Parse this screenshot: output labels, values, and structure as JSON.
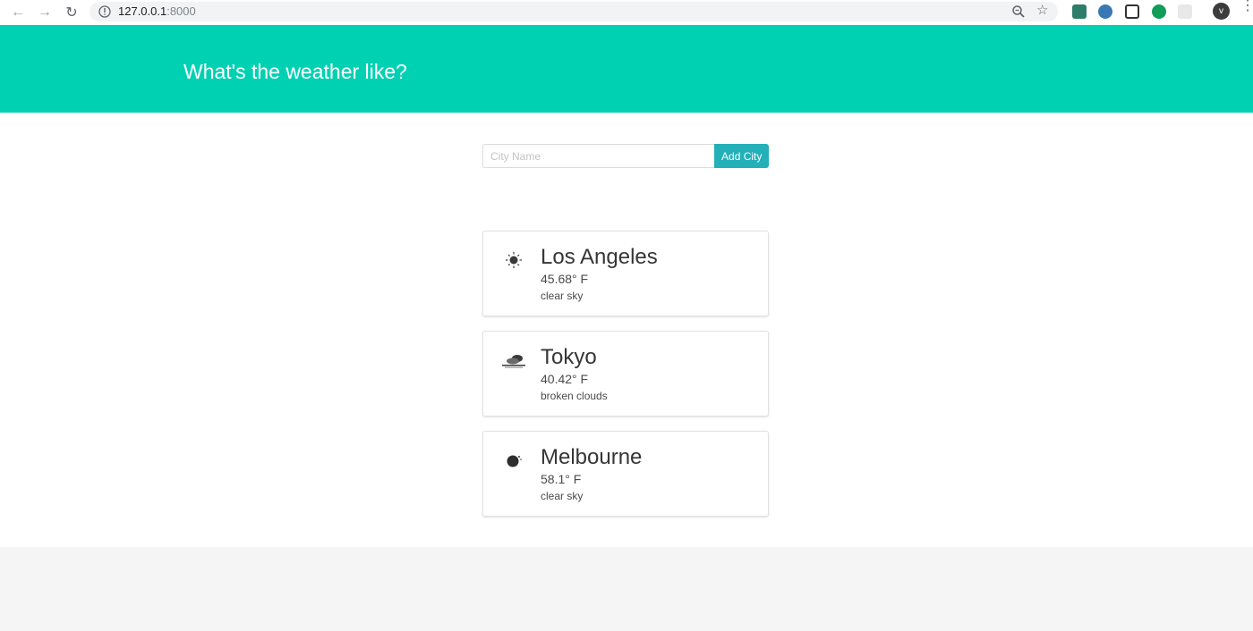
{
  "browser": {
    "url_host": "127.0.0.1",
    "url_port": ":8000",
    "avatar_letter": "v"
  },
  "header": {
    "title": "What's the weather like?"
  },
  "form": {
    "placeholder": "City Name",
    "value": "",
    "button_label": "Add City"
  },
  "cities": [
    {
      "name": "Los Angeles",
      "temperature": "45.68° F",
      "description": "clear sky",
      "icon": "sun-icon"
    },
    {
      "name": "Tokyo",
      "temperature": "40.42° F",
      "description": "broken clouds",
      "icon": "broken-clouds-icon"
    },
    {
      "name": "Melbourne",
      "temperature": "58.1° F",
      "description": "clear sky",
      "icon": "moon-icon"
    }
  ],
  "colors": {
    "hero": "#00d1b2",
    "button": "#23b0b8",
    "footer": "#f5f5f5"
  }
}
